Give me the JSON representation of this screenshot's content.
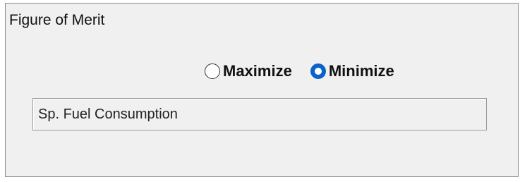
{
  "group": {
    "title": "Figure of Merit"
  },
  "options": {
    "maximize": {
      "label": "Maximize",
      "checked": false
    },
    "minimize": {
      "label": "Minimize",
      "checked": true
    }
  },
  "field": {
    "value": "Sp. Fuel Consumption"
  },
  "colors": {
    "panel_bg": "#f0f0f0",
    "radio_accent": "#0a63c9",
    "border": "#8a8a8a"
  }
}
